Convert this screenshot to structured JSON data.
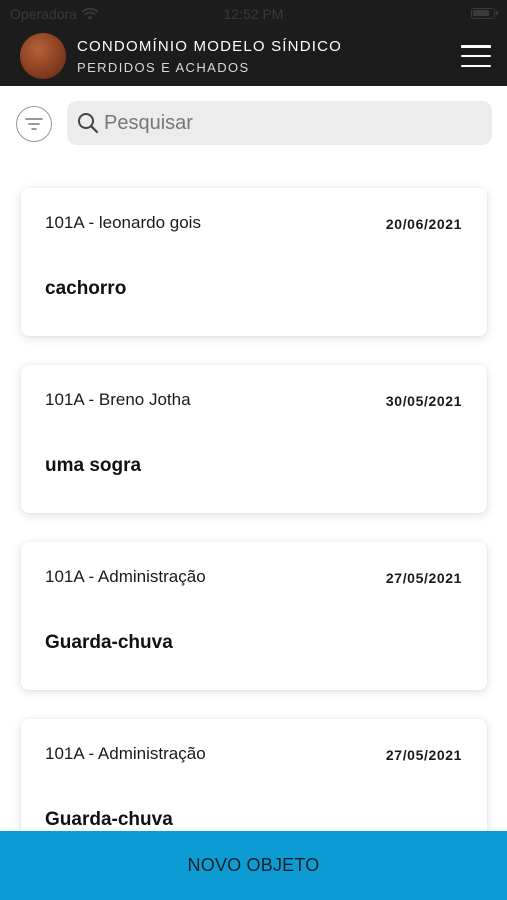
{
  "status_bar": {
    "carrier": "Operadora",
    "time": "12:52 PM"
  },
  "header": {
    "title": "CONDOMÍNIO MODELO SÍNDICO",
    "subtitle": "PERDIDOS E ACHADOS",
    "menu_icon": "hamburger-menu-icon"
  },
  "search": {
    "placeholder": "Pesquisar",
    "value": "",
    "filter_icon": "filter-icon",
    "search_icon": "search-icon"
  },
  "items": [
    {
      "owner": "101A - leonardo gois",
      "date": "20/06/2021",
      "object": "cachorro"
    },
    {
      "owner": "101A - Breno Jotha",
      "date": "30/05/2021",
      "object": "uma sogra"
    },
    {
      "owner": "101A - Administração",
      "date": "27/05/2021",
      "object": "Guarda-chuva"
    },
    {
      "owner": "101A - Administração",
      "date": "27/05/2021",
      "object": "Guarda-chuva"
    }
  ],
  "actions": {
    "new_object_label": "NOVO OBJETO"
  },
  "colors": {
    "header_bg": "#1c1c1c",
    "accent": "#0d9bd3"
  }
}
